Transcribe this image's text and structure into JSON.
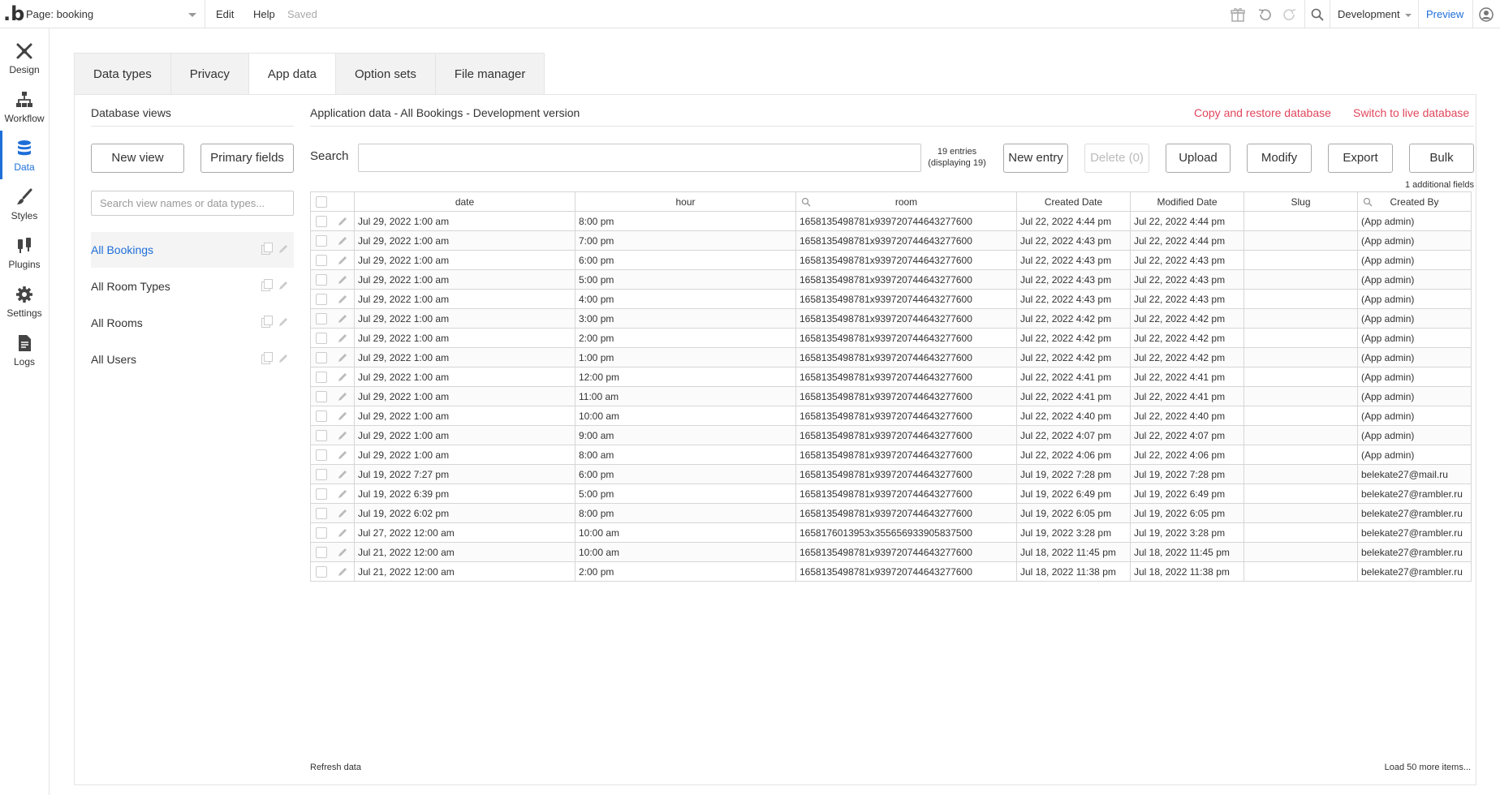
{
  "topbar": {
    "logo": "b",
    "page_select": "Page: booking",
    "edit": "Edit",
    "help": "Help",
    "saved": "Saved",
    "environment": "Development",
    "preview": "Preview",
    "icons": [
      "gift-icon",
      "undo-icon",
      "redo-icon",
      "search-icon",
      "user-icon"
    ]
  },
  "leftnav": {
    "items": [
      {
        "label": "Design",
        "icon": "design-icon"
      },
      {
        "label": "Workflow",
        "icon": "workflow-icon"
      },
      {
        "label": "Data",
        "icon": "database-icon",
        "active": true
      },
      {
        "label": "Styles",
        "icon": "brush-icon"
      },
      {
        "label": "Plugins",
        "icon": "plug-icon"
      },
      {
        "label": "Settings",
        "icon": "gear-icon"
      },
      {
        "label": "Logs",
        "icon": "document-icon"
      }
    ]
  },
  "tabs": [
    "Data types",
    "Privacy",
    "App data",
    "Option sets",
    "File manager"
  ],
  "active_tab": "App data",
  "db_views": {
    "title": "Database views",
    "new_view": "New view",
    "primary_fields": "Primary fields",
    "search_placeholder": "Search view names or data types...",
    "items": [
      "All Bookings",
      "All Room Types",
      "All Rooms",
      "All Users"
    ],
    "active": "All Bookings"
  },
  "data": {
    "title": "Application data - All Bookings - Development version",
    "copy_restore": "Copy and restore database",
    "switch_live": "Switch to live database",
    "search_label": "Search",
    "entries_line1": "19 entries",
    "entries_line2": "(displaying 19)",
    "new_entry": "New entry",
    "delete": "Delete (0)",
    "upload": "Upload",
    "modify": "Modify",
    "export": "Export",
    "bulk": "Bulk",
    "additional_fields": "1 additional fields",
    "refresh": "Refresh data",
    "load_more": "Load 50 more items..."
  },
  "table": {
    "columns": [
      "date",
      "hour",
      "room",
      "Created Date",
      "Modified Date",
      "Slug",
      "Created By"
    ],
    "rows": [
      [
        "Jul 29, 2022 1:00 am",
        "8:00 pm",
        "1658135498781x939720744643277600",
        "Jul 22, 2022 4:44 pm",
        "Jul 22, 2022 4:44 pm",
        "",
        "(App admin)"
      ],
      [
        "Jul 29, 2022 1:00 am",
        "7:00 pm",
        "1658135498781x939720744643277600",
        "Jul 22, 2022 4:43 pm",
        "Jul 22, 2022 4:44 pm",
        "",
        "(App admin)"
      ],
      [
        "Jul 29, 2022 1:00 am",
        "6:00 pm",
        "1658135498781x939720744643277600",
        "Jul 22, 2022 4:43 pm",
        "Jul 22, 2022 4:43 pm",
        "",
        "(App admin)"
      ],
      [
        "Jul 29, 2022 1:00 am",
        "5:00 pm",
        "1658135498781x939720744643277600",
        "Jul 22, 2022 4:43 pm",
        "Jul 22, 2022 4:43 pm",
        "",
        "(App admin)"
      ],
      [
        "Jul 29, 2022 1:00 am",
        "4:00 pm",
        "1658135498781x939720744643277600",
        "Jul 22, 2022 4:43 pm",
        "Jul 22, 2022 4:43 pm",
        "",
        "(App admin)"
      ],
      [
        "Jul 29, 2022 1:00 am",
        "3:00 pm",
        "1658135498781x939720744643277600",
        "Jul 22, 2022 4:42 pm",
        "Jul 22, 2022 4:42 pm",
        "",
        "(App admin)"
      ],
      [
        "Jul 29, 2022 1:00 am",
        "2:00 pm",
        "1658135498781x939720744643277600",
        "Jul 22, 2022 4:42 pm",
        "Jul 22, 2022 4:42 pm",
        "",
        "(App admin)"
      ],
      [
        "Jul 29, 2022 1:00 am",
        "1:00 pm",
        "1658135498781x939720744643277600",
        "Jul 22, 2022 4:42 pm",
        "Jul 22, 2022 4:42 pm",
        "",
        "(App admin)"
      ],
      [
        "Jul 29, 2022 1:00 am",
        "12:00 pm",
        "1658135498781x939720744643277600",
        "Jul 22, 2022 4:41 pm",
        "Jul 22, 2022 4:41 pm",
        "",
        "(App admin)"
      ],
      [
        "Jul 29, 2022 1:00 am",
        "11:00 am",
        "1658135498781x939720744643277600",
        "Jul 22, 2022 4:41 pm",
        "Jul 22, 2022 4:41 pm",
        "",
        "(App admin)"
      ],
      [
        "Jul 29, 2022 1:00 am",
        "10:00 am",
        "1658135498781x939720744643277600",
        "Jul 22, 2022 4:40 pm",
        "Jul 22, 2022 4:40 pm",
        "",
        "(App admin)"
      ],
      [
        "Jul 29, 2022 1:00 am",
        "9:00 am",
        "1658135498781x939720744643277600",
        "Jul 22, 2022 4:07 pm",
        "Jul 22, 2022 4:07 pm",
        "",
        "(App admin)"
      ],
      [
        "Jul 29, 2022 1:00 am",
        "8:00 am",
        "1658135498781x939720744643277600",
        "Jul 22, 2022 4:06 pm",
        "Jul 22, 2022 4:06 pm",
        "",
        "(App admin)"
      ],
      [
        "Jul 19, 2022 7:27 pm",
        "6:00 pm",
        "1658135498781x939720744643277600",
        "Jul 19, 2022 7:28 pm",
        "Jul 19, 2022 7:28 pm",
        "",
        "belekate27@mail.ru"
      ],
      [
        "Jul 19, 2022 6:39 pm",
        "5:00 pm",
        "1658135498781x939720744643277600",
        "Jul 19, 2022 6:49 pm",
        "Jul 19, 2022 6:49 pm",
        "",
        "belekate27@rambler.ru"
      ],
      [
        "Jul 19, 2022 6:02 pm",
        "8:00 pm",
        "1658135498781x939720744643277600",
        "Jul 19, 2022 6:05 pm",
        "Jul 19, 2022 6:05 pm",
        "",
        "belekate27@rambler.ru"
      ],
      [
        "Jul 27, 2022 12:00 am",
        "10:00 am",
        "1658176013953x355656933905837500",
        "Jul 19, 2022 3:28 pm",
        "Jul 19, 2022 3:28 pm",
        "",
        "belekate27@rambler.ru"
      ],
      [
        "Jul 21, 2022 12:00 am",
        "10:00 am",
        "1658135498781x939720744643277600",
        "Jul 18, 2022 11:45 pm",
        "Jul 18, 2022 11:45 pm",
        "",
        "belekate27@rambler.ru"
      ],
      [
        "Jul 21, 2022 12:00 am",
        "2:00 pm",
        "1658135498781x939720744643277600",
        "Jul 18, 2022 11:38 pm",
        "Jul 18, 2022 11:38 pm",
        "",
        "belekate27@rambler.ru"
      ]
    ]
  },
  "colors": {
    "accent": "#1e6ed8",
    "danger_link": "#e0465c",
    "border": "#e4e4e4"
  }
}
